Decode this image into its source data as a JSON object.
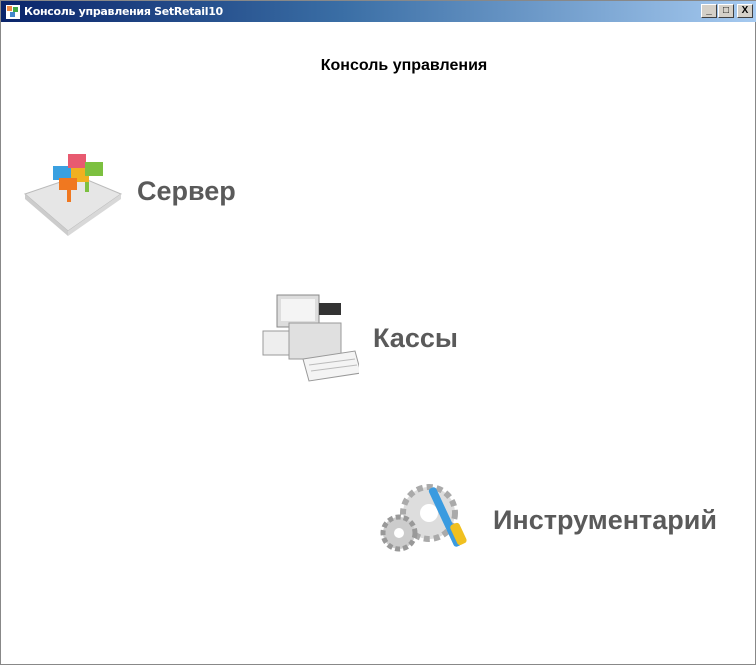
{
  "window": {
    "title": "Консоль управления SetRetail10",
    "minimize": "_",
    "maximize": "□",
    "close": "X"
  },
  "heading": "Консоль управления",
  "items": [
    {
      "label": "Сервер",
      "icon": "puzzle-server-icon"
    },
    {
      "label": "Кассы",
      "icon": "cash-register-icon"
    },
    {
      "label": "Инструментарий",
      "icon": "gears-tools-icon"
    }
  ]
}
